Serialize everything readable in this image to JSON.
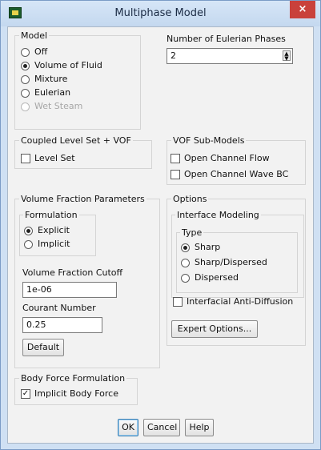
{
  "window": {
    "title": "Multiphase Model",
    "close_label": "×"
  },
  "model": {
    "title": "Model",
    "options": [
      {
        "label": "Off",
        "selected": false,
        "enabled": true
      },
      {
        "label": "Volume of Fluid",
        "selected": true,
        "enabled": true
      },
      {
        "label": "Mixture",
        "selected": false,
        "enabled": true
      },
      {
        "label": "Eulerian",
        "selected": false,
        "enabled": true
      },
      {
        "label": "Wet Steam",
        "selected": false,
        "enabled": false
      }
    ]
  },
  "eulerian_phases": {
    "label": "Number of Eulerian Phases",
    "value": "2"
  },
  "coupled": {
    "title": "Coupled Level Set + VOF",
    "level_set": {
      "label": "Level Set",
      "checked": false
    }
  },
  "vof_sub_models": {
    "title": "VOF Sub-Models",
    "items": [
      {
        "label": "Open Channel Flow",
        "checked": false
      },
      {
        "label": "Open Channel Wave BC",
        "checked": false
      }
    ]
  },
  "vf_params": {
    "title": "Volume Fraction Parameters",
    "formulation": {
      "title": "Formulation",
      "options": [
        {
          "label": "Explicit",
          "selected": true
        },
        {
          "label": "Implicit",
          "selected": false
        }
      ]
    },
    "cutoff": {
      "label": "Volume Fraction Cutoff",
      "value": "1e-06"
    },
    "courant": {
      "label": "Courant Number",
      "value": "0.25"
    },
    "default_button": "Default"
  },
  "options": {
    "title": "Options",
    "interface_modeling": {
      "title": "Interface Modeling",
      "type": {
        "title": "Type",
        "options": [
          {
            "label": "Sharp",
            "selected": true
          },
          {
            "label": "Sharp/Dispersed",
            "selected": false
          },
          {
            "label": "Dispersed",
            "selected": false
          }
        ]
      }
    },
    "anti_diffusion": {
      "label": "Interfacial Anti-Diffusion",
      "checked": false
    },
    "expert_button": "Expert Options..."
  },
  "body_force": {
    "title": "Body Force Formulation",
    "implicit": {
      "label": "Implicit Body Force",
      "checked": true
    }
  },
  "footer": {
    "ok": "OK",
    "cancel": "Cancel",
    "help": "Help"
  },
  "colors": {
    "title_bar": "#c4d8ef",
    "close": "#c9413b",
    "dialog_bg": "#f2f2f2"
  }
}
